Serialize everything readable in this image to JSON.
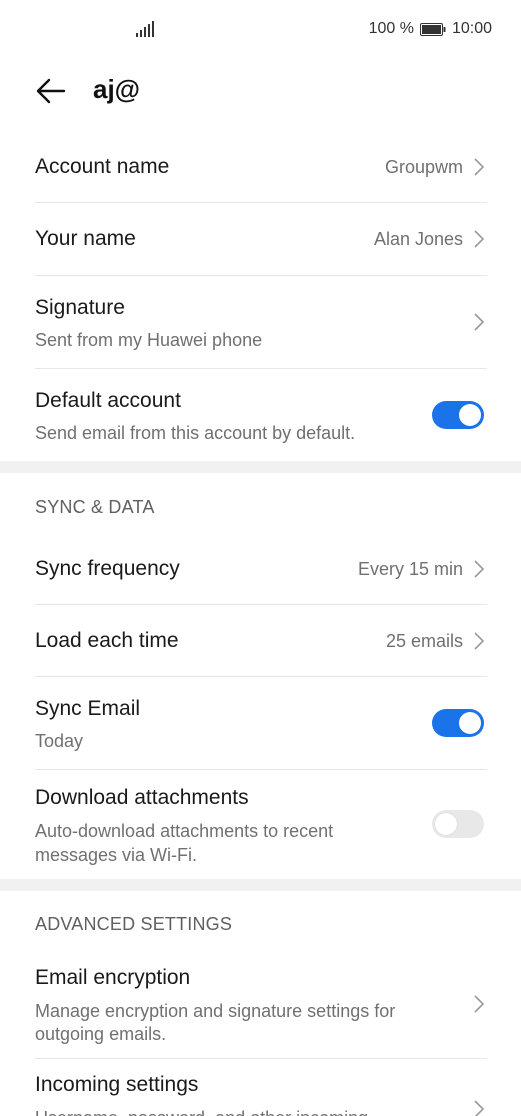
{
  "status_bar": {
    "battery_text": "100 %",
    "time": "10:00"
  },
  "header": {
    "title": "aj@"
  },
  "account": {
    "account_name": {
      "label": "Account name",
      "value": "Groupwm"
    },
    "your_name": {
      "label": "Your name",
      "value": "Alan Jones"
    },
    "signature": {
      "label": "Signature",
      "subtitle": "Sent from my Huawei phone"
    },
    "default_account": {
      "label": "Default account",
      "subtitle": "Send email from this account by default.",
      "enabled": true
    }
  },
  "sync_data": {
    "section_title": "SYNC & DATA",
    "sync_frequency": {
      "label": "Sync frequency",
      "value": "Every 15 min"
    },
    "load_each_time": {
      "label": "Load each time",
      "value": "25 emails"
    },
    "sync_email": {
      "label": "Sync Email",
      "subtitle": "Today",
      "enabled": true
    },
    "download_attachments": {
      "label": "Download attachments",
      "subtitle_line1": "Auto-download attachments to recent",
      "subtitle_line2": "messages via Wi-Fi.",
      "enabled": false
    }
  },
  "advanced": {
    "section_title": "ADVANCED SETTINGS",
    "email_encryption": {
      "label": "Email encryption",
      "subtitle_line1": "Manage encryption and signature settings for",
      "subtitle_line2": "outgoing emails."
    },
    "incoming_settings": {
      "label": "Incoming settings",
      "subtitle_line1": "Username, password, and other incoming"
    }
  },
  "colors": {
    "accent": "#1a73e8",
    "section_background": "#f1f1f1",
    "divider": "#e6e6e6",
    "secondary_text": "#707070"
  },
  "icons": {
    "signal": "signal-bars-icon",
    "battery": "battery-icon",
    "back": "back-arrow-icon",
    "chevron": "chevron-right-icon"
  }
}
